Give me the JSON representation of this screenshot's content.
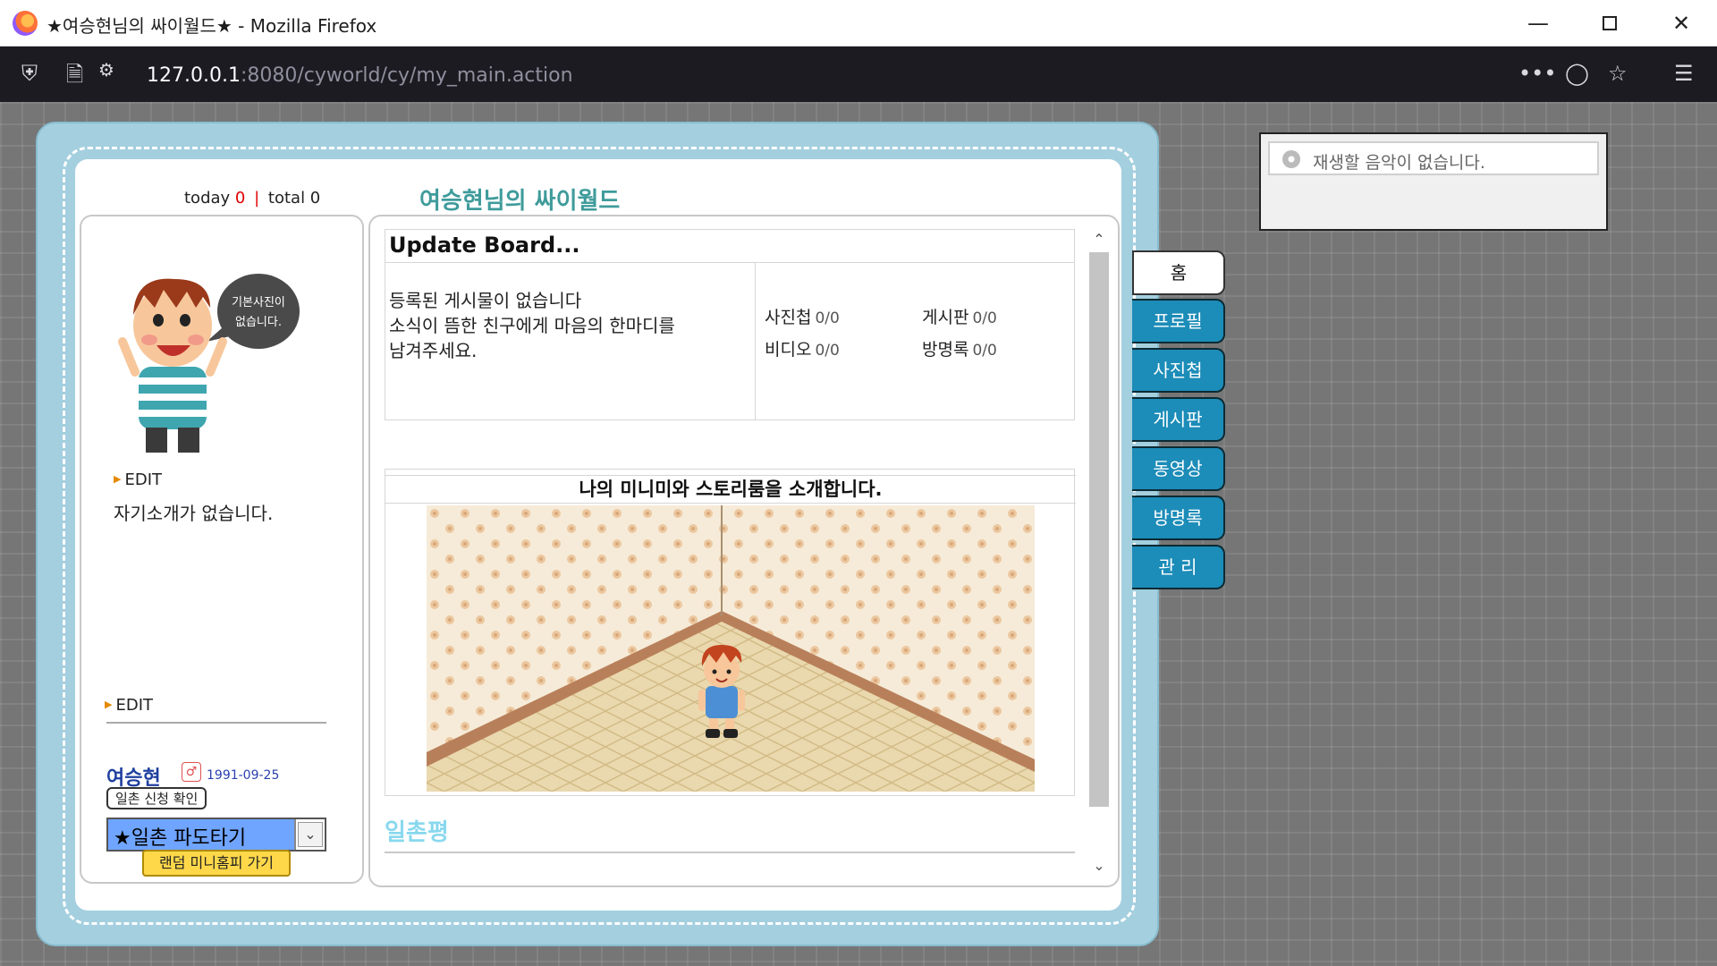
{
  "window": {
    "title": "★여승현님의 싸이월드★ - Mozilla Firefox",
    "minimize_icon": "minimize-icon",
    "maximize_icon": "maximize-icon",
    "close_icon": "close-icon"
  },
  "toolbar": {
    "url_host": "127.0.0.1",
    "url_path": ":8080/cyworld/cy/my_main.action"
  },
  "music": {
    "status": "재생할 음악이 없습니다."
  },
  "header": {
    "today_label": "today",
    "today_count": "0",
    "separator": "|",
    "total_label": "total 0",
    "homepage_title": "여승현님의 싸이월드"
  },
  "profile": {
    "image_caption_line1": "기본사진이",
    "image_caption_line2": "없습니다.",
    "edit_label_1": "EDIT",
    "intro": "자기소개가 없습니다.",
    "edit_label_2": "EDIT",
    "name": "여승현",
    "gender_badge": "♂",
    "birthdate": "1991-09-25",
    "ilchon_request": "일촌 신청 확인",
    "pado_select": "★일촌 파도타기",
    "random_button": "랜덤 미니홈피 가기"
  },
  "update_board": {
    "title": "Update Board...",
    "message_line1": "등록된 게시물이 없습니다",
    "message_line2": "소식이 뜸한 친구에게 마음의 한마디를",
    "message_line3": "남겨주세요.",
    "photo_label": "사진첩",
    "photo_count": "0/0",
    "board_label": "게시판",
    "board_count": "0/0",
    "video_label": "비디오",
    "video_count": "0/0",
    "guestbook_label": "방명록",
    "guestbook_count": "0/0"
  },
  "miniroom": {
    "title": "나의 미니미와 스토리룸을 소개합니다."
  },
  "ilchon": {
    "title": "일촌평"
  },
  "tabs": [
    {
      "label": "홈",
      "active": true
    },
    {
      "label": "프로필",
      "active": false
    },
    {
      "label": "사진첩",
      "active": false
    },
    {
      "label": "게시판",
      "active": false
    },
    {
      "label": "동영상",
      "active": false
    },
    {
      "label": "방명록",
      "active": false
    },
    {
      "label": "관 리",
      "active": false
    }
  ],
  "colors": {
    "book_frame": "#a4cfdf",
    "tab_blue": "#1c8cb8",
    "title_teal": "#3f9b9b",
    "ilchon_title": "#88d8ee"
  }
}
